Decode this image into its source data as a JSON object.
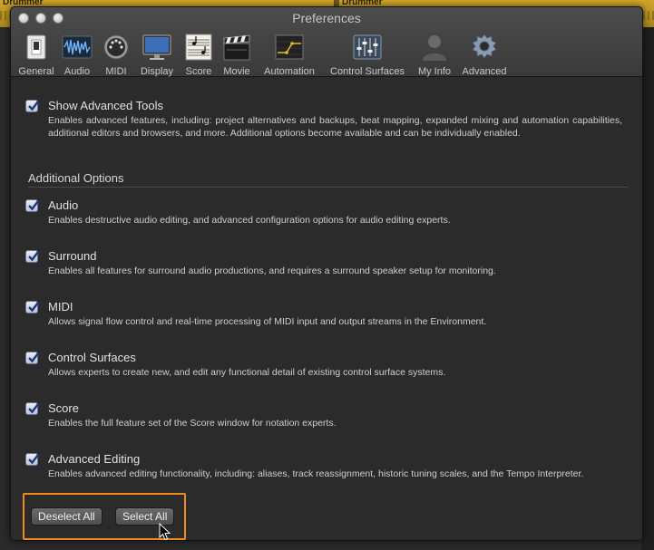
{
  "background": {
    "region_label_left": "Drummer",
    "region_label_right": "Drummer"
  },
  "window": {
    "title": "Preferences",
    "toolbar": [
      {
        "label": "General",
        "icon": "switch-icon"
      },
      {
        "label": "Audio",
        "icon": "audio-waveform-icon"
      },
      {
        "label": "MIDI",
        "icon": "midi-connector-icon"
      },
      {
        "label": "Display",
        "icon": "monitor-icon"
      },
      {
        "label": "Score",
        "icon": "score-sheet-icon"
      },
      {
        "label": "Movie",
        "icon": "clapperboard-icon"
      },
      {
        "label": "Automation",
        "icon": "automation-curve-icon"
      },
      {
        "label": "Control Surfaces",
        "icon": "mixer-faders-icon"
      },
      {
        "label": "My Info",
        "icon": "user-silhouette-icon"
      },
      {
        "label": "Advanced",
        "icon": "gear-icon"
      }
    ]
  },
  "content": {
    "show_advanced": {
      "title": "Show Advanced Tools",
      "desc": "Enables advanced features, including: project alternatives and backups, beat mapping, expanded mixing and automation capabilities, additional editors and browsers, and more. Additional options become available and can be individually enabled.",
      "checked": true
    },
    "additional_header": "Additional Options",
    "options": [
      {
        "title": "Audio",
        "desc": "Enables destructive audio editing, and advanced configuration options for audio editing experts.",
        "checked": true
      },
      {
        "title": "Surround",
        "desc": "Enables all features for surround audio productions, and requires a surround speaker setup for monitoring.",
        "checked": true
      },
      {
        "title": "MIDI",
        "desc": "Allows signal flow control and real-time processing of MIDI input and output streams in the Environment.",
        "checked": true
      },
      {
        "title": "Control Surfaces",
        "desc": "Allows experts to create new, and edit any functional detail of existing control surface systems.",
        "checked": true
      },
      {
        "title": "Score",
        "desc": "Enables the full feature set of the Score window for notation experts.",
        "checked": true
      },
      {
        "title": "Advanced Editing",
        "desc": "Enables advanced editing functionality, including: aliases, track reassignment, historic tuning scales, and the Tempo Interpreter.",
        "checked": true
      }
    ],
    "buttons": {
      "deselect_all": "Deselect All",
      "select_all": "Select All"
    },
    "highlight_color": "#f08a1a"
  }
}
